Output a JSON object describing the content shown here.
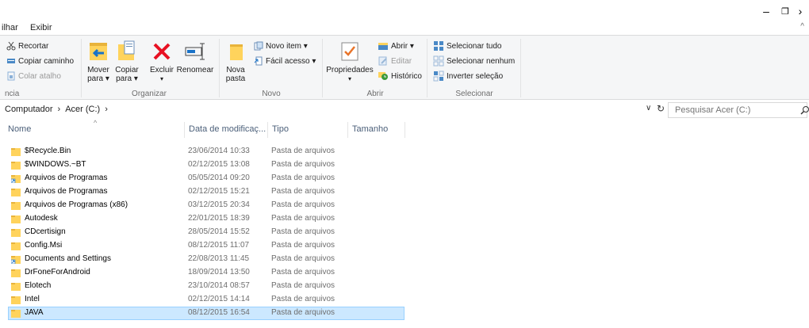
{
  "window": {
    "minimize_glyph": "–",
    "restore_glyph": "❐",
    "next_glyph": "›"
  },
  "tabs": [
    {
      "label": "ilhar"
    },
    {
      "label": "Exibir"
    }
  ],
  "ribbon": {
    "clipboard": {
      "cut": "Recortar",
      "copy_path": "Copiar caminho",
      "paste_shortcut": "Colar atalho",
      "group_label": "ncia"
    },
    "organize": {
      "move_to": "Mover para ▾",
      "copy_to": "Copiar para ▾",
      "delete": "Excluir",
      "rename": "Renomear",
      "group_label": "Organizar"
    },
    "new": {
      "new_folder": "Nova pasta",
      "new_item": "Novo item ▾",
      "easy_access": "Fácil acesso ▾",
      "group_label": "Novo"
    },
    "open": {
      "properties": "Propriedades",
      "open": "Abrir ▾",
      "edit": "Editar",
      "history": "Histórico",
      "group_label": "Abrir"
    },
    "select": {
      "select_all": "Selecionar tudo",
      "select_none": "Selecionar nenhum",
      "invert": "Inverter seleção",
      "group_label": "Selecionar"
    }
  },
  "address": {
    "crumbs": [
      "Computador",
      "›",
      "Acer (C:)",
      "›"
    ],
    "search_placeholder": "Pesquisar Acer (C:)"
  },
  "columns": {
    "name": "Nome",
    "date": "Data de modificaç...",
    "type": "Tipo",
    "size": "Tamanho"
  },
  "files": [
    {
      "name": "$Recycle.Bin",
      "date": "23/06/2014 10:33",
      "type": "Pasta de arquivos",
      "shortcut": false,
      "selected": false
    },
    {
      "name": "$WINDOWS.~BT",
      "date": "02/12/2015 13:08",
      "type": "Pasta de arquivos",
      "shortcut": false,
      "selected": false
    },
    {
      "name": "Arquivos de Programas",
      "date": "05/05/2014 09:20",
      "type": "Pasta de arquivos",
      "shortcut": true,
      "selected": false
    },
    {
      "name": "Arquivos de Programas",
      "date": "02/12/2015 15:21",
      "type": "Pasta de arquivos",
      "shortcut": false,
      "selected": false
    },
    {
      "name": "Arquivos de Programas (x86)",
      "date": "03/12/2015 20:34",
      "type": "Pasta de arquivos",
      "shortcut": false,
      "selected": false
    },
    {
      "name": "Autodesk",
      "date": "22/01/2015 18:39",
      "type": "Pasta de arquivos",
      "shortcut": false,
      "selected": false
    },
    {
      "name": "CDcertisign",
      "date": "28/05/2014 15:52",
      "type": "Pasta de arquivos",
      "shortcut": false,
      "selected": false
    },
    {
      "name": "Config.Msi",
      "date": "08/12/2015 11:07",
      "type": "Pasta de arquivos",
      "shortcut": false,
      "selected": false
    },
    {
      "name": "Documents and Settings",
      "date": "22/08/2013 11:45",
      "type": "Pasta de arquivos",
      "shortcut": true,
      "selected": false
    },
    {
      "name": "DrFoneForAndroid",
      "date": "18/09/2014 13:50",
      "type": "Pasta de arquivos",
      "shortcut": false,
      "selected": false
    },
    {
      "name": "Elotech",
      "date": "23/10/2014 08:57",
      "type": "Pasta de arquivos",
      "shortcut": false,
      "selected": false
    },
    {
      "name": "Intel",
      "date": "02/12/2015 14:14",
      "type": "Pasta de arquivos",
      "shortcut": false,
      "selected": false
    },
    {
      "name": "JAVA",
      "date": "08/12/2015 16:54",
      "type": "Pasta de arquivos",
      "shortcut": false,
      "selected": true
    }
  ],
  "colors": {
    "folder": "#ffd35c",
    "folder_dark": "#e8b33b",
    "selection": "#cce8ff",
    "selection_border": "#99d1ff",
    "accent": "#1a73c8",
    "delete_red": "#e81123"
  }
}
